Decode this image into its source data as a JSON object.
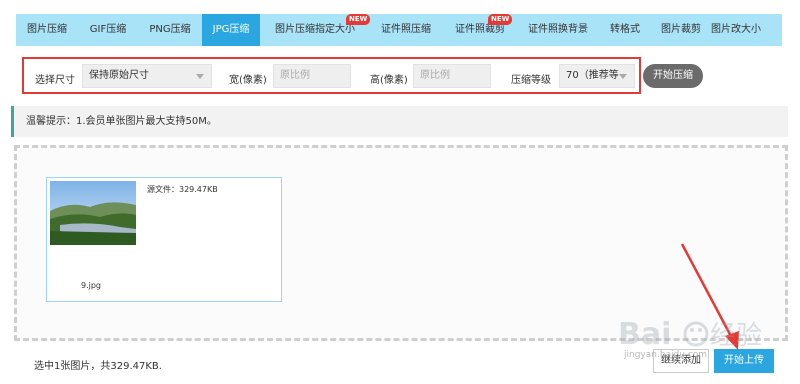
{
  "tabs": [
    {
      "label": "图片压缩",
      "active": false,
      "badge": ""
    },
    {
      "label": "GIF压缩",
      "active": false,
      "badge": ""
    },
    {
      "label": "PNG压缩",
      "active": false,
      "badge": ""
    },
    {
      "label": "JPG压缩",
      "active": true,
      "badge": ""
    },
    {
      "label": "图片压缩指定大小",
      "active": false,
      "badge": "NEW"
    },
    {
      "label": "证件照压缩",
      "active": false,
      "badge": ""
    },
    {
      "label": "证件照裁剪",
      "active": false,
      "badge": "NEW"
    },
    {
      "label": "证件照换背景",
      "active": false,
      "badge": ""
    },
    {
      "label": "转格式",
      "active": false,
      "badge": ""
    },
    {
      "label": "图片裁剪",
      "active": false,
      "badge": ""
    },
    {
      "label": "图片改大小",
      "active": false,
      "badge": ""
    }
  ],
  "settings": {
    "size_label": "选择尺寸",
    "size_value": "保持原始尺寸",
    "width_label": "宽(像素)",
    "width_placeholder": "原比例",
    "height_label": "高(像素)",
    "height_placeholder": "原比例",
    "quality_label": "压缩等级",
    "quality_value": "70（推荐等",
    "start_label": "开始压缩"
  },
  "notice": "温馨提示：1.会员单张图片最大支持50M。",
  "file": {
    "source_info": "源文件：329.47KB",
    "name": "9.jpg"
  },
  "footer": {
    "summary": "选中1张图片，共329.47KB.",
    "continue_label": "继续添加",
    "upload_label": "开始上传"
  },
  "watermark": {
    "text": "jingyan.baidu.com"
  },
  "colors": {
    "tabbar_bg": "#a9e3f7",
    "active_tab": "#2aa7e0",
    "highlight_border": "#e03a3a",
    "start_button": "#6b6b6b",
    "upload_button": "#2aa7e0",
    "arrow": "#e53935"
  }
}
